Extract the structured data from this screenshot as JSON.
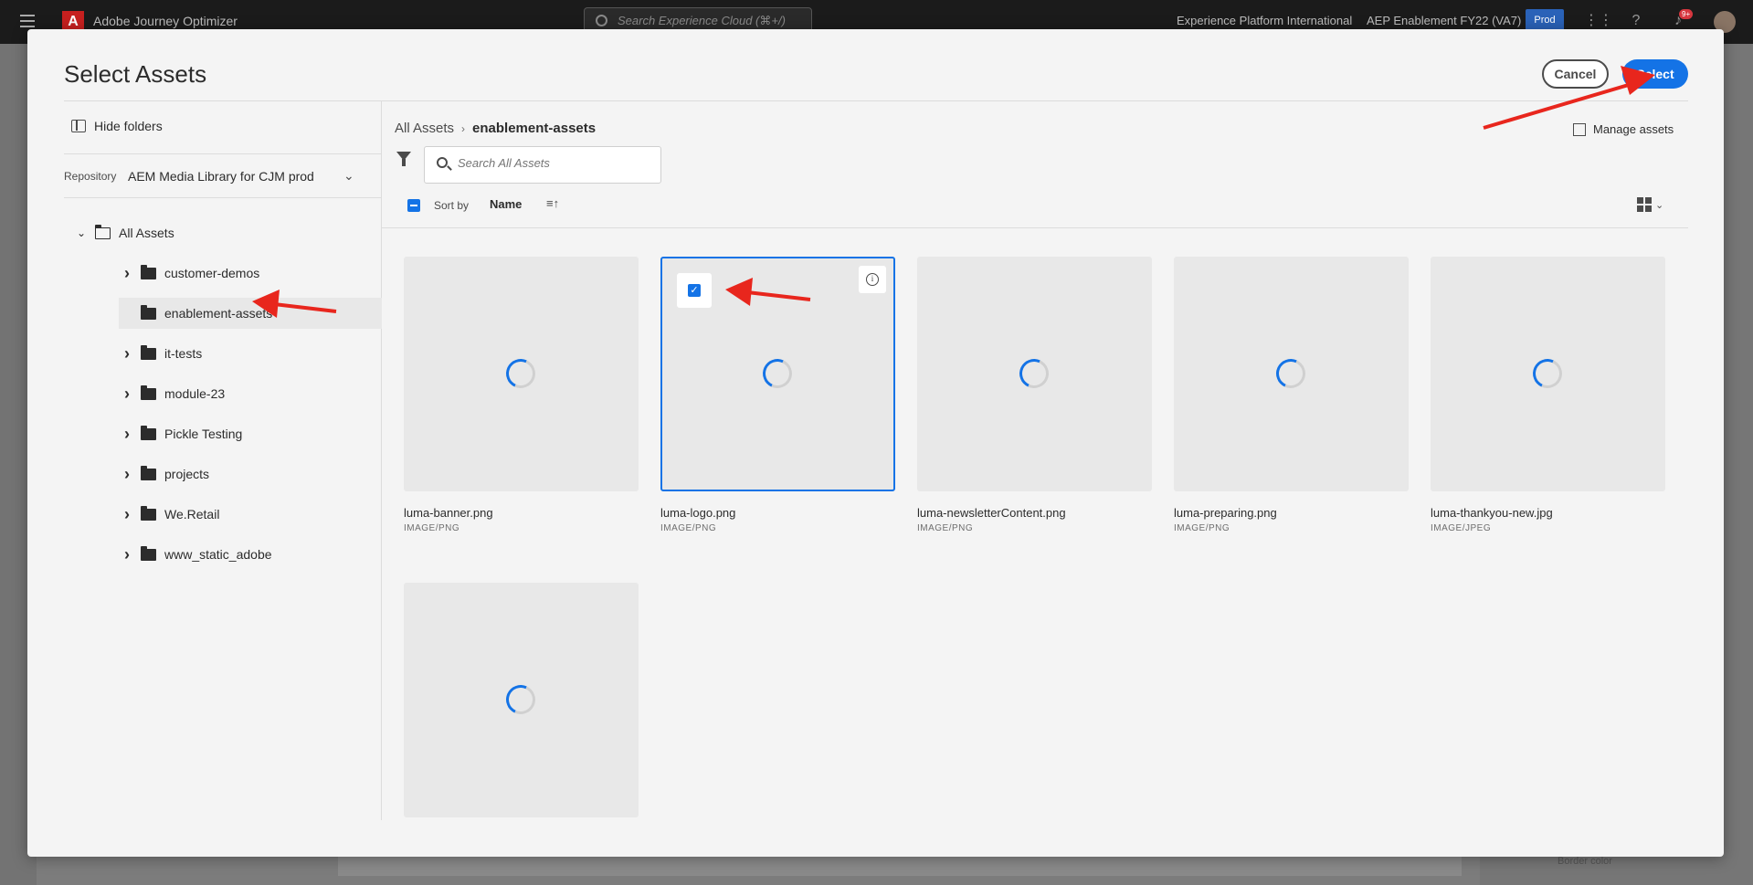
{
  "app": {
    "name": "Adobe Journey Optimizer",
    "logo_letter": "A",
    "search_placeholder": "Search Experience Cloud (⌘+/)",
    "org": "Experience Platform International",
    "sandbox": "AEP Enablement FY22 (VA7)",
    "environment": "Prod",
    "notification_count": "9+"
  },
  "background": {
    "border_color_label": "Border color"
  },
  "modal": {
    "title": "Select Assets",
    "cancel_label": "Cancel",
    "select_label": "Select"
  },
  "folders_panel": {
    "hide_folders_label": "Hide folders",
    "repository_label": "Repository",
    "repository_value": "AEM Media Library for CJM prod",
    "root": "All Assets",
    "items": [
      {
        "label": "customer-demos",
        "expandable": true,
        "selected": false
      },
      {
        "label": "enablement-assets",
        "expandable": false,
        "selected": true
      },
      {
        "label": "it-tests",
        "expandable": true,
        "selected": false
      },
      {
        "label": "module-23",
        "expandable": true,
        "selected": false
      },
      {
        "label": "Pickle Testing",
        "expandable": true,
        "selected": false
      },
      {
        "label": "projects",
        "expandable": true,
        "selected": false
      },
      {
        "label": "We.Retail",
        "expandable": true,
        "selected": false
      },
      {
        "label": "www_static_adobe",
        "expandable": true,
        "selected": false
      }
    ]
  },
  "content": {
    "breadcrumb_root": "All Assets",
    "breadcrumb_current": "enablement-assets",
    "manage_assets_label": "Manage assets",
    "search_placeholder": "Search All Assets",
    "sort_by_label": "Sort by",
    "sort_field": "Name",
    "assets": [
      {
        "name": "luma-banner.png",
        "type": "IMAGE/PNG",
        "selected": false
      },
      {
        "name": "luma-logo.png",
        "type": "IMAGE/PNG",
        "selected": true
      },
      {
        "name": "luma-newsletterContent.png",
        "type": "IMAGE/PNG",
        "selected": false
      },
      {
        "name": "luma-preparing.png",
        "type": "IMAGE/PNG",
        "selected": false
      },
      {
        "name": "luma-thankyou-new.jpg",
        "type": "IMAGE/JPEG",
        "selected": false
      },
      {
        "name": "",
        "type": "",
        "selected": false
      }
    ]
  },
  "colors": {
    "accent": "#1473e6",
    "annotation_arrow": "#e8261d"
  }
}
